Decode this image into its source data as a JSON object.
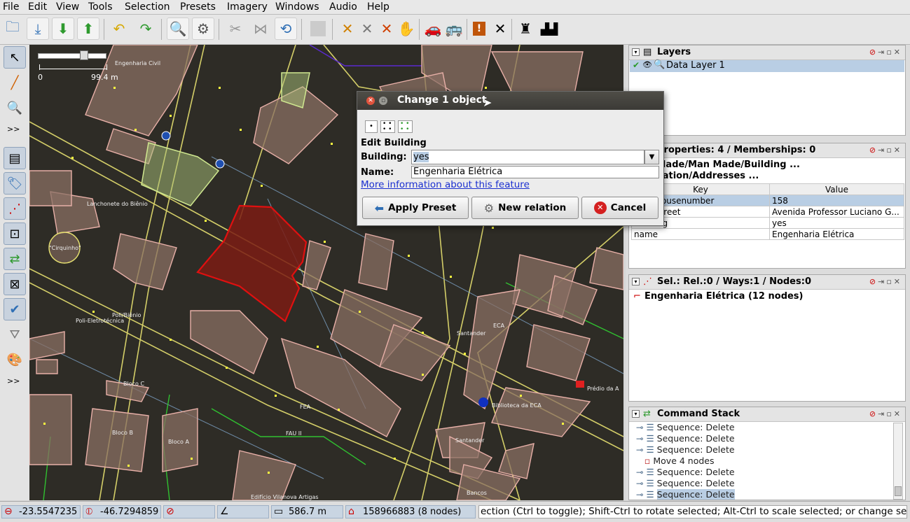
{
  "menu": [
    "File",
    "Edit",
    "View",
    "Tools",
    "Selection",
    "Presets",
    "Imagery",
    "Windows",
    "Audio",
    "Help"
  ],
  "map": {
    "scale_start": "0",
    "scale_end": "99.4 m",
    "labels": {
      "engenharia_civil": "Engenharia Civil",
      "lanchonete": "Lanchonete do Biênio",
      "cirquinho": "\"Cirquinho\"",
      "poli_bienio": "Poli/Biênio",
      "poli_eletrotecnica": "Poli-Eletrotécnica",
      "bloco_c": "Bloco C",
      "bloco_b": "Bloco B",
      "bloco_a": "Bloco A",
      "fea": "FEA",
      "fau": "FAU II",
      "eca": "ECA",
      "santander_top": "Santander",
      "santander": "Santander",
      "biblioteca": "Biblioteca da ECA",
      "predio": "Prédio da A",
      "bancos": "Bancos",
      "vilanova": "Edifício Vilanova Artigas"
    }
  },
  "panels": {
    "layers": {
      "title": "Layers",
      "item": "Data Layer 1"
    },
    "properties": {
      "title": "Properties: 4 / Memberships: 0",
      "preset1": "Man Made/Man Made/Building ...",
      "preset2": "Annotation/Addresses ...",
      "key_header": "Key",
      "value_header": "Value",
      "rows": [
        {
          "key": "addr:housenumber",
          "value": "158"
        },
        {
          "key": "addr:street",
          "value": "Avenida Professor Luciano G..."
        },
        {
          "key": "building",
          "value": "yes"
        },
        {
          "key": "name",
          "value": "Engenharia Elétrica"
        }
      ]
    },
    "selection": {
      "title": "Sel.: Rel.:0 / Ways:1 / Nodes:0",
      "item": "Engenharia Elétrica (12 nodes)"
    },
    "command_stack": {
      "title": "Command Stack",
      "items": [
        "Sequence: Delete",
        "Sequence: Delete",
        "Sequence: Delete",
        "Move 4 nodes",
        "Sequence: Delete",
        "Sequence: Delete",
        "Sequence: Delete"
      ]
    }
  },
  "dialog": {
    "title": "Change 1 object",
    "section": "Edit Building",
    "building_label": "Building:",
    "building_value": "yes",
    "name_label": "Name:",
    "name_value": "Engenharia Elétrica",
    "more_info": "More information about this feature",
    "apply": "Apply Preset",
    "new_relation": "New relation",
    "cancel": "Cancel"
  },
  "status": {
    "lat": "-23.5547235",
    "lon": "-46.7294859",
    "distance": "586.7 m",
    "way": "158966883 (8 nodes)",
    "message": "ection (Ctrl to toggle); Shift-Ctrl to rotate selected; Alt-Ctrl to scale selected; or change selection"
  },
  "colors": {
    "map_bg": "#2e2c26",
    "building_fill": "#8a6f63",
    "building_outline": "#e8b0a8",
    "selected": "#e01010",
    "node": "#ffff40",
    "highlight": "#b9cee4"
  }
}
